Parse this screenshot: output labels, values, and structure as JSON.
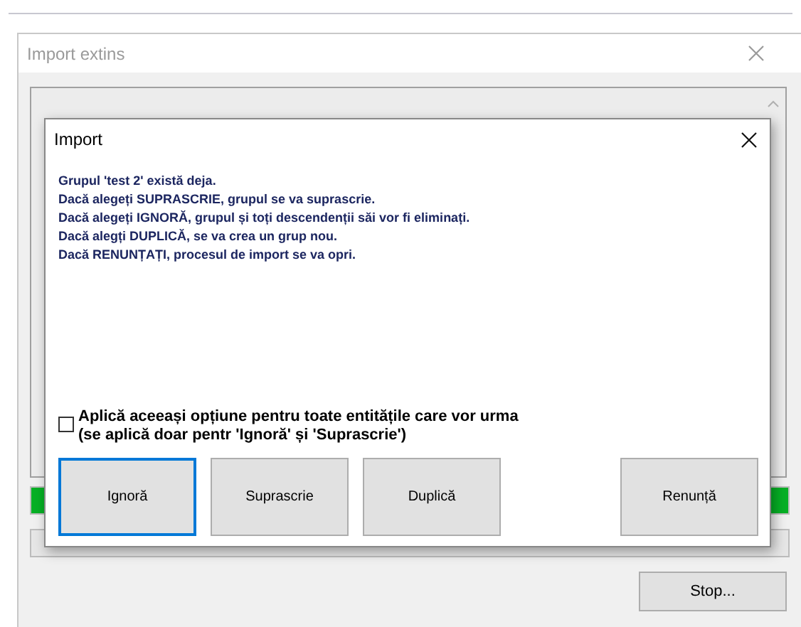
{
  "window": {
    "title": "Import extins"
  },
  "progress_bars": [
    {
      "level": 1
    }
  ],
  "stop_button": "Stop...",
  "dialog": {
    "title": "Import",
    "message": [
      "Grupul 'test 2' există deja.",
      "Dacă alegeți SUPRASCRIE, grupul se va suprascrie.",
      "Dacă alegeți IGNORĂ, grupul și toți descendenții săi vor fi eliminați.",
      "Dacă alegți DUPLICĂ, se va crea un grup nou.",
      "Dacă RENUNȚAȚI, procesul de import se va opri."
    ],
    "checkbox": {
      "label": [
        "Aplică aceeași opțiune pentru toate entitățile care vor urma",
        "(se aplică doar pentr 'Ignoră' și 'Suprascrie')"
      ],
      "checked": false
    },
    "buttons": [
      {
        "label": "Ignoră",
        "focused": true
      },
      {
        "label": "Suprascrie",
        "focused": false
      },
      {
        "label": "Duplică",
        "focused": false
      },
      {
        "label": "Renunță",
        "focused": false
      }
    ]
  }
}
